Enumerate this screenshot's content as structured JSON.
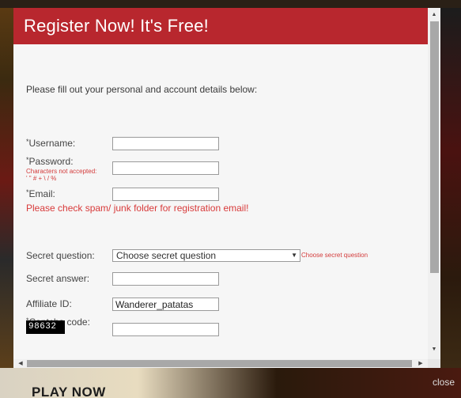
{
  "dialog": {
    "title": "Register Now! It's Free!",
    "intro": "Please fill out your personal and account details below:",
    "close_label": "close"
  },
  "fields": {
    "required_mark": "*",
    "username": {
      "label": "Username:",
      "value": ""
    },
    "password": {
      "label": "Password:",
      "note_line1": "Characters not accepted:",
      "note_line2": "' \" # + \\ / %",
      "value": ""
    },
    "email": {
      "label": "Email:",
      "value": ""
    },
    "spam_warning": "Please check spam/ junk folder for registration email!",
    "secret_question": {
      "label": "Secret question:",
      "selected": "Choose secret question",
      "hint": "Choose secret question"
    },
    "secret_answer": {
      "label": "Secret answer:",
      "value": ""
    },
    "affiliate_id": {
      "label": "Affiliate ID:",
      "value": "Wanderer_patatas"
    },
    "captcha": {
      "label": "Captcha code:",
      "image_code": "98632",
      "value": ""
    }
  },
  "background": {
    "play_now": "PLAY NOW"
  },
  "colors": {
    "header": "#b8272e",
    "warning": "#d83a3a",
    "dialog_bg": "#f6f6f6"
  }
}
